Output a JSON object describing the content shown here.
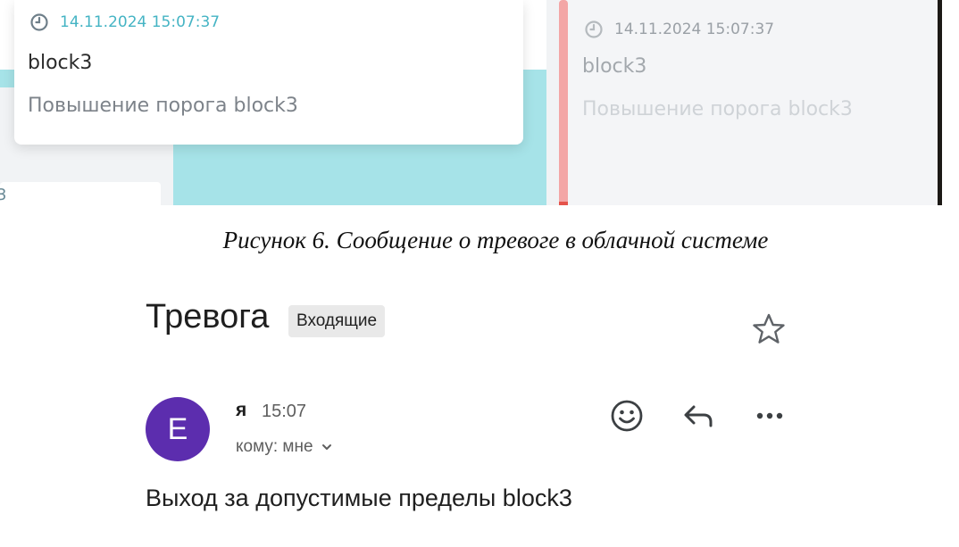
{
  "cloud": {
    "popup": {
      "timestamp": "14.11.2024 15:07:37",
      "title": "block3",
      "description": "Повышение порога block3"
    },
    "list_item": {
      "timestamp": "14.11.2024 15:07:37",
      "title": "block3",
      "description": "Повышение порога block3"
    },
    "partial_card_text": "3"
  },
  "caption": "Рисунок 6. Сообщение о тревоге в облачной системе",
  "email": {
    "subject": "Тревога",
    "label": "Входящие",
    "sender": {
      "avatar_letter": "E",
      "name": "я",
      "time": "15:07",
      "recipient": "кому: мне"
    },
    "actions": [
      "emoji-icon",
      "reply-icon",
      "more-icon"
    ],
    "body": "Выход за допустимые пределы block3"
  },
  "colors": {
    "accent_teal": "#45b4c4",
    "teal_panel": "#a6e3e8",
    "alert_bar": "#f3a6a6",
    "avatar": "#5c2dae"
  }
}
